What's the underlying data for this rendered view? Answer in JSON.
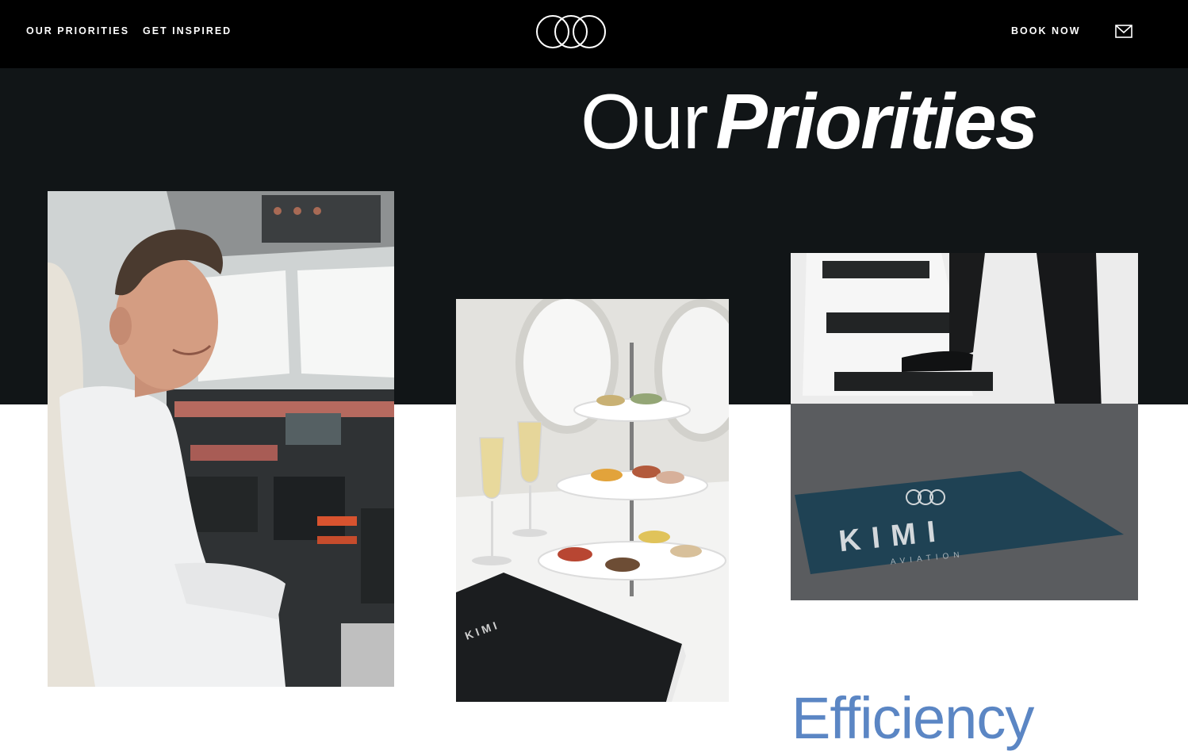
{
  "nav": {
    "priorities": "OUR PRIORITIES",
    "inspired": "GET INSPIRED",
    "book": "BOOK NOW",
    "mail_icon": "mail-icon",
    "logo_icon": "three-rings-logo"
  },
  "hero": {
    "title_light": "Our",
    "title_bold": "Priorities"
  },
  "photos": {
    "food": {
      "menu_text": "KIMI"
    },
    "stairs": {
      "mat_brand": "KIMI",
      "mat_sub": "AVIATION"
    }
  },
  "section": {
    "heading": "Efficiency"
  },
  "colors": {
    "nav_bg": "#000000",
    "band_bg": "#111517",
    "heading_blue": "#5b86c4"
  }
}
